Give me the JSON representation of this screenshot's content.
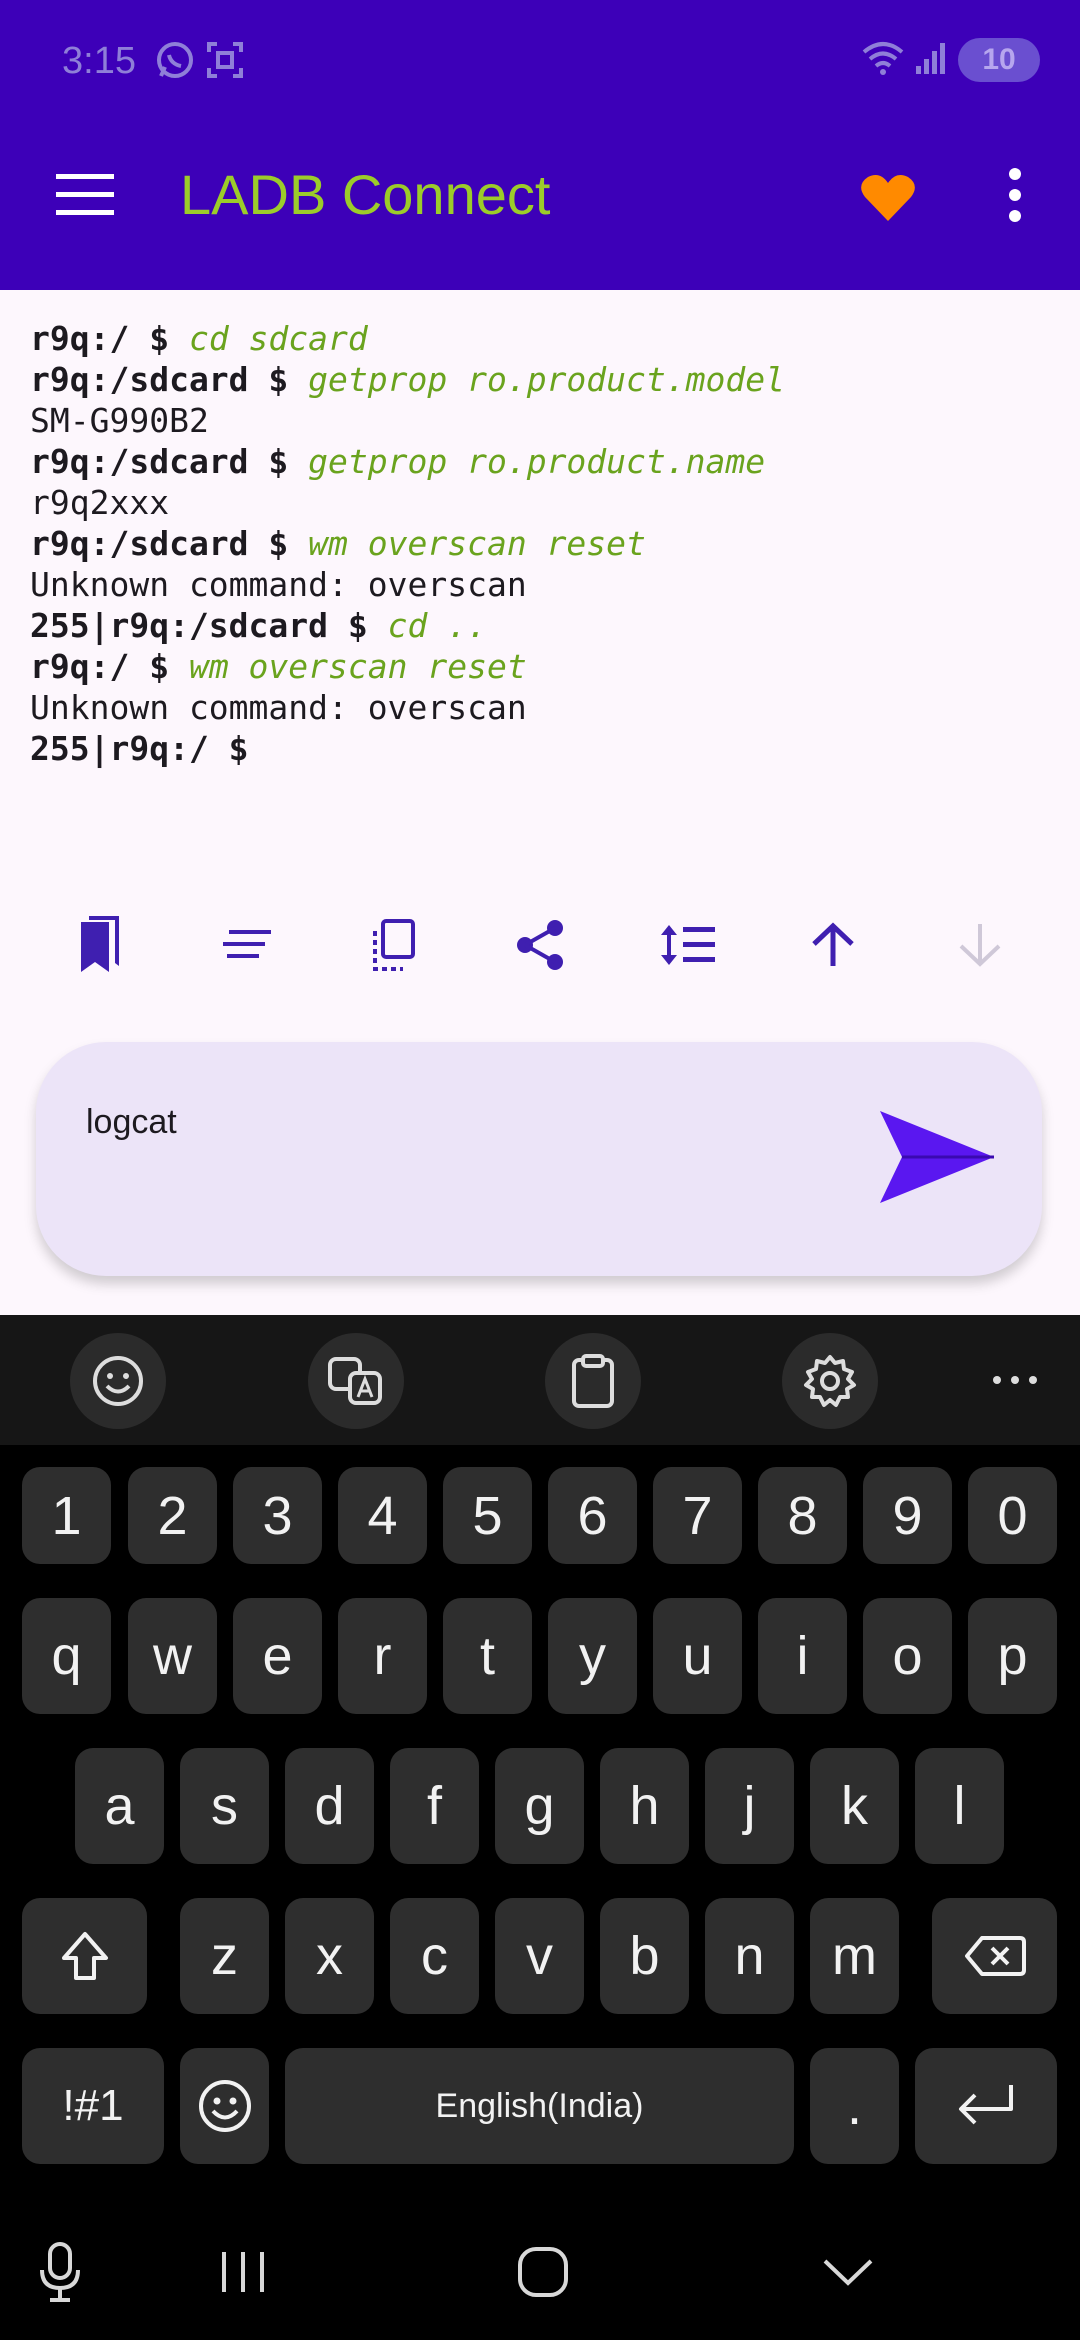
{
  "status_bar": {
    "time": "3:15",
    "battery": "10",
    "icons": [
      "whatsapp-icon",
      "screenshot-icon",
      "wifi-icon",
      "signal-icon",
      "battery-icon"
    ]
  },
  "app_bar": {
    "title": "LADB Connect",
    "title_color": "#9ccc2a",
    "background": "#3d00b8",
    "heart_color": "#ff8a00"
  },
  "terminal": {
    "lines": [
      {
        "prompt": "r9q:/ $ ",
        "cmd": "cd sdcard",
        "out": ""
      },
      {
        "prompt": "r9q:/sdcard $ ",
        "cmd": "getprop ro.product.model",
        "out": ""
      },
      {
        "prompt": "",
        "cmd": "",
        "out": "SM-G990B2"
      },
      {
        "prompt": "r9q:/sdcard $ ",
        "cmd": "getprop ro.product.name",
        "out": ""
      },
      {
        "prompt": "",
        "cmd": "",
        "out": "r9q2xxx"
      },
      {
        "prompt": "r9q:/sdcard $ ",
        "cmd": "wm overscan reset",
        "out": ""
      },
      {
        "prompt": "",
        "cmd": "",
        "out": "Unknown command: overscan"
      },
      {
        "prompt": "255|r9q:/sdcard $ ",
        "cmd": "cd ..",
        "out": ""
      },
      {
        "prompt": "r9q:/ $ ",
        "cmd": "wm overscan reset",
        "out": ""
      },
      {
        "prompt": "",
        "cmd": "",
        "out": "Unknown command: overscan"
      },
      {
        "prompt": "255|r9q:/ $",
        "cmd": "",
        "out": ""
      }
    ]
  },
  "actions": [
    "bookmarks-icon",
    "history-icon",
    "copy-icon",
    "share-icon",
    "line-spacing-icon",
    "scroll-up-icon",
    "scroll-down-icon"
  ],
  "input": {
    "value": "logcat"
  },
  "keyboard": {
    "toolbar": [
      "emoji-icon",
      "translate-icon",
      "clipboard-icon",
      "settings-icon",
      "more-icon"
    ],
    "row_numbers": [
      "1",
      "2",
      "3",
      "4",
      "5",
      "6",
      "7",
      "8",
      "9",
      "0"
    ],
    "row_1": [
      "q",
      "w",
      "e",
      "r",
      "t",
      "y",
      "u",
      "i",
      "o",
      "p"
    ],
    "row_2": [
      "a",
      "s",
      "d",
      "f",
      "g",
      "h",
      "j",
      "k",
      "l"
    ],
    "row_3": [
      "z",
      "x",
      "c",
      "v",
      "b",
      "n",
      "m"
    ],
    "symbols_label": "!#1",
    "space_label": "English(India)",
    "period_label": "."
  },
  "nav_bar": [
    "mic-icon",
    "recents-icon",
    "home-icon",
    "hide-keyboard-icon"
  ]
}
